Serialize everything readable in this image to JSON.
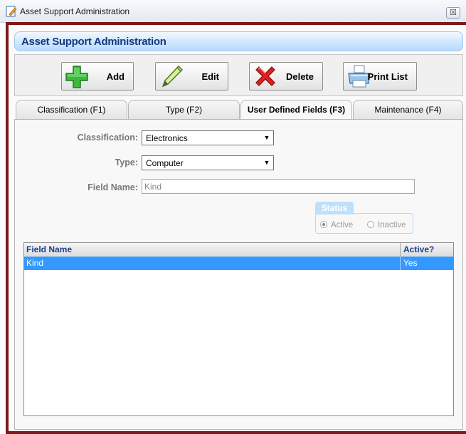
{
  "window": {
    "title": "Asset Support Administration",
    "close_glyph": "☒"
  },
  "header": {
    "title": "Asset Support Administration"
  },
  "toolbar": {
    "add_label": "Add",
    "edit_label": "Edit",
    "delete_label": "Delete",
    "print_label": "Print List"
  },
  "tabs": [
    {
      "label": "Classification (F1)"
    },
    {
      "label": "Type (F2)"
    },
    {
      "label": "User Defined Fields (F3)",
      "active": true
    },
    {
      "label": "Maintenance (F4)"
    }
  ],
  "form": {
    "classification_label": "Classification:",
    "classification_value": "Electronics",
    "type_label": "Type:",
    "type_value": "Computer",
    "field_name_label": "Field Name:",
    "field_name_value": "Kind"
  },
  "status": {
    "legend": "Status",
    "active_label": "Active",
    "inactive_label": "Inactive",
    "selected": "Active"
  },
  "grid": {
    "columns": [
      "Field Name",
      "Active?"
    ],
    "rows": [
      [
        "Kind",
        "Yes"
      ]
    ]
  },
  "colors": {
    "selection": "#3399ff",
    "header_text": "#143a80",
    "frame_border": "#7a1a1a"
  }
}
